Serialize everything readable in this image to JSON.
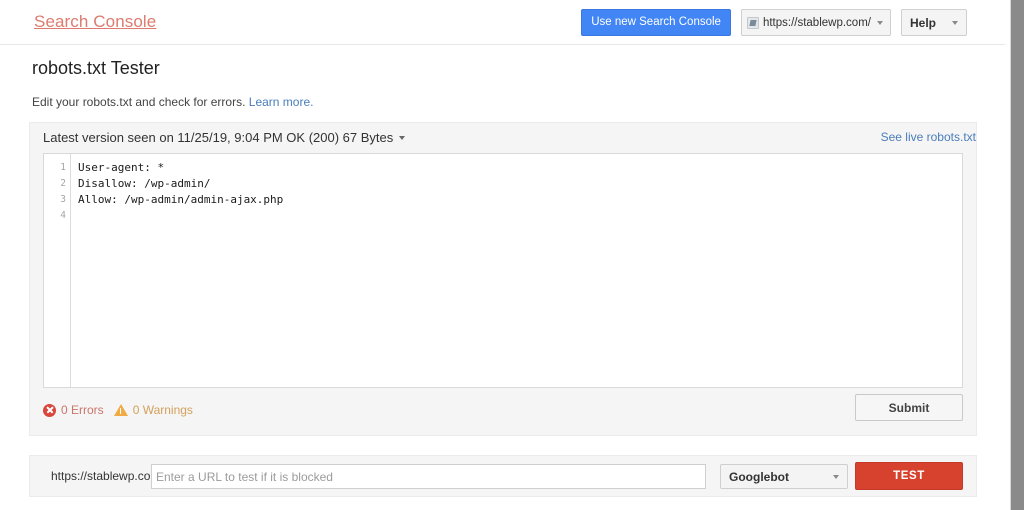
{
  "header": {
    "brand": "Search Console",
    "new_console_button": "Use new Search Console",
    "site_selector": {
      "label": "https://stablewp.com/",
      "icon": "site-favicon-icon"
    },
    "help_button": "Help"
  },
  "page": {
    "title": "robots.txt Tester",
    "subtitle_text": "Edit your robots.txt and check for errors.",
    "subtitle_link": "Learn more."
  },
  "editor_panel": {
    "version_label": "Latest version seen on 11/25/19, 9:04 PM OK (200) 67 Bytes",
    "live_link": "See live robots.txt",
    "line_numbers": [
      "1",
      "2",
      "3",
      "4"
    ],
    "lines": [
      "User-agent: *",
      "Disallow: /wp-admin/",
      "Allow: /wp-admin/admin-ajax.php",
      ""
    ],
    "errors_label": "0 Errors",
    "warnings_label": "0 Warnings",
    "submit_button": "Submit"
  },
  "test_bar": {
    "url_prefix": "https://stablewp.com/",
    "url_placeholder": "Enter a URL to test if it is blocked",
    "url_value": "",
    "user_agent": "Googlebot",
    "test_button": "TEST"
  },
  "colors": {
    "brand": "#dd7b6f",
    "primary_blue": "#4285f4",
    "link_blue": "#4a7ebb",
    "test_red": "#d7422e",
    "error_red": "#d8463c",
    "warning_orange": "#f0ab44",
    "panel_bg": "#f5f5f5"
  }
}
